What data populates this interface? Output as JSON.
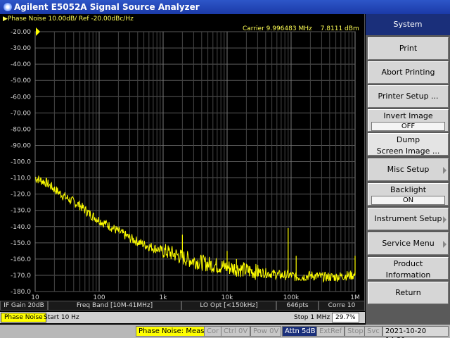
{
  "window": {
    "title": "Agilent E5052A Signal Source Analyzer"
  },
  "graph": {
    "trace_label": "Phase Noise 10.00dB/ Ref -20.00dBc/Hz",
    "carrier_label": "Carrier 9.996483 MHz",
    "carrier_power": "7.8111 dBm",
    "trace_color": "#ffff00"
  },
  "chart_data": {
    "type": "line",
    "xscale": "log",
    "xlim": [
      10,
      1000000
    ],
    "ylim": [
      -180,
      -20
    ],
    "yticks": [
      "-20.00",
      "-30.00",
      "-40.00",
      "-50.00",
      "-60.00",
      "-70.00",
      "-80.00",
      "-90.00",
      "-100.0",
      "-110.0",
      "-120.0",
      "-130.0",
      "-140.0",
      "-150.0",
      "-160.0",
      "-170.0",
      "-180.0"
    ],
    "xticks": [
      "10",
      "100",
      "1k",
      "10k",
      "100k",
      "1M"
    ],
    "grid": true,
    "series": [
      {
        "x": [
          10,
          15,
          20,
          30,
          50,
          70,
          100,
          150,
          200,
          300,
          500,
          700,
          1000,
          1500,
          2000,
          3000,
          5000,
          7000,
          10000,
          15000,
          20000,
          30000,
          50000,
          70000,
          90000,
          100000,
          120000,
          150000,
          200000,
          300000,
          500000,
          800000,
          1000000
        ],
        "y": [
          -110,
          -113,
          -117,
          -122,
          -127,
          -132,
          -136,
          -140,
          -143,
          -147,
          -151,
          -153,
          -155,
          -157,
          -159,
          -161,
          -163,
          -164,
          -165,
          -166,
          -167,
          -168,
          -169,
          -170,
          -170,
          -142,
          -171,
          -171,
          -170,
          -171,
          -171,
          -170,
          -170
        ]
      }
    ],
    "spurs": [
      {
        "x": 2000,
        "y": -145
      },
      {
        "x": 3500,
        "y": -163
      },
      {
        "x": 10000,
        "y": -155
      },
      {
        "x": 14000,
        "y": -160
      },
      {
        "x": 90000,
        "y": -141
      },
      {
        "x": 120000,
        "y": -158
      },
      {
        "x": 1000000,
        "y": -158
      }
    ]
  },
  "status": {
    "if_gain": "IF Gain 20dB",
    "freq_band": "Freq Band [10M-41MHz]",
    "lo_opt": "LO Opt [<150kHz]",
    "points": "646pts",
    "corre": "Corre 10"
  },
  "meas": {
    "mode": "Phase Noise",
    "start": "Start 10 Hz",
    "stop": "Stop 1 MHz",
    "pct": "29.7%"
  },
  "statusbar": {
    "meas": "Phase Noise: Meas",
    "cor": "Cor",
    "ctrl": "Ctrl  0V",
    "pow": "Pow  0V",
    "attn": "Attn 5dB",
    "extref": "ExtRef",
    "stop": "Stop",
    "svc": "Svc",
    "datetime": "2021-10-20 14:21"
  },
  "softkeys": {
    "title": "System",
    "print": "Print",
    "abort": "Abort Printing",
    "printer_setup": "Printer Setup ...",
    "invert_label": "Invert Image",
    "invert_value": "OFF",
    "dump_l1": "Dump",
    "dump_l2": "Screen Image ...",
    "misc": "Misc Setup",
    "backlight_label": "Backlight",
    "backlight_value": "ON",
    "instrument": "Instrument Setup",
    "service": "Service Menu",
    "product_l1": "Product",
    "product_l2": "Information",
    "return": "Return"
  }
}
